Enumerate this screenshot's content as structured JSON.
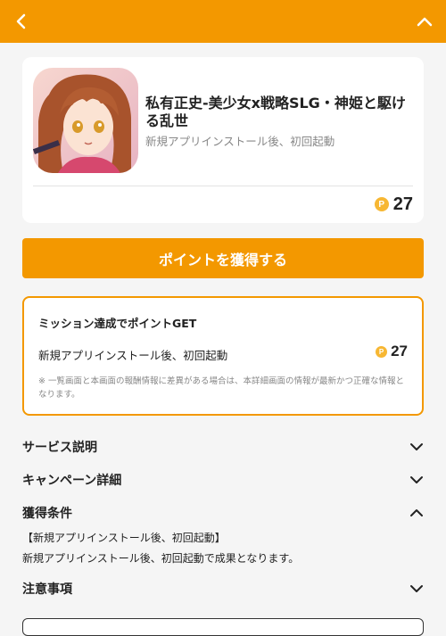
{
  "header": {
    "back_icon": "chevron-left-icon",
    "collapse_icon": "chevron-up-icon",
    "color": "#f39800"
  },
  "app": {
    "title": "私有正史-美少女x戦略SLG・神姫と駆ける乱世",
    "subtitle": "新規アプリインストール後、初回起動",
    "points": "27",
    "point_icon_glyph": "P"
  },
  "cta": {
    "label": "ポイントを獲得する"
  },
  "mission": {
    "title": "ミッション達成でポイントGET",
    "item_label": "新規アプリインストール後、初回起動",
    "item_points": "27",
    "note": "※ 一覧画面と本画面の報酬情報に差異がある場合は、本詳細画面の情報が最新かつ正確な情報となります。"
  },
  "sections": [
    {
      "label": "サービス説明",
      "state": "collapsed"
    },
    {
      "label": "キャンペーン詳細",
      "state": "collapsed"
    },
    {
      "label": "獲得条件",
      "state": "expanded"
    },
    {
      "label": "注意事項",
      "state": "collapsed"
    }
  ],
  "conditions": {
    "heading": "【新規アプリインストール後、初回起動】",
    "body": "新規アプリインストール後、初回起動で成果となります。"
  },
  "colors": {
    "accent": "#f39800",
    "points_coin": "#f7b733",
    "muted_text": "#888888"
  }
}
